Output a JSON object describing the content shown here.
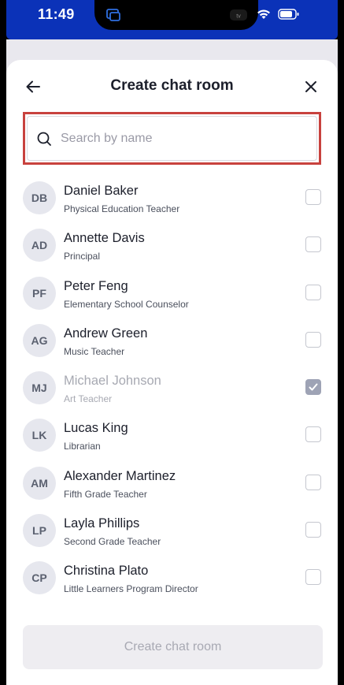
{
  "status_bar": {
    "time": "11:49",
    "background_color": "#0b32b8",
    "icons": [
      "wifi-icon",
      "battery-icon"
    ]
  },
  "header": {
    "title": "Create chat room",
    "back_icon": "arrow-left-icon",
    "close_icon": "close-icon"
  },
  "search": {
    "placeholder": "Search by name",
    "value": "",
    "icon": "search-icon",
    "highlight_color": "#c8423e"
  },
  "contacts": [
    {
      "initials": "DB",
      "name": "Daniel Baker",
      "role": "Physical Education Teacher",
      "checked": false,
      "disabled": false
    },
    {
      "initials": "AD",
      "name": "Annette Davis",
      "role": "Principal",
      "checked": false,
      "disabled": false
    },
    {
      "initials": "PF",
      "name": "Peter Feng",
      "role": "Elementary School Counselor",
      "checked": false,
      "disabled": false
    },
    {
      "initials": "AG",
      "name": "Andrew Green",
      "role": "Music Teacher",
      "checked": false,
      "disabled": false
    },
    {
      "initials": "MJ",
      "name": "Michael Johnson",
      "role": "Art Teacher",
      "checked": true,
      "disabled": true
    },
    {
      "initials": "LK",
      "name": "Lucas King",
      "role": "Librarian",
      "checked": false,
      "disabled": false
    },
    {
      "initials": "AM",
      "name": "Alexander Martinez",
      "role": "Fifth Grade Teacher",
      "checked": false,
      "disabled": false
    },
    {
      "initials": "LP",
      "name": "Layla Phillips",
      "role": "Second Grade Teacher",
      "checked": false,
      "disabled": false
    },
    {
      "initials": "CP",
      "name": "Christina Plato",
      "role": "Little Learners Program Director",
      "checked": false,
      "disabled": false
    }
  ],
  "footer": {
    "button_label": "Create chat room",
    "button_enabled": false
  }
}
